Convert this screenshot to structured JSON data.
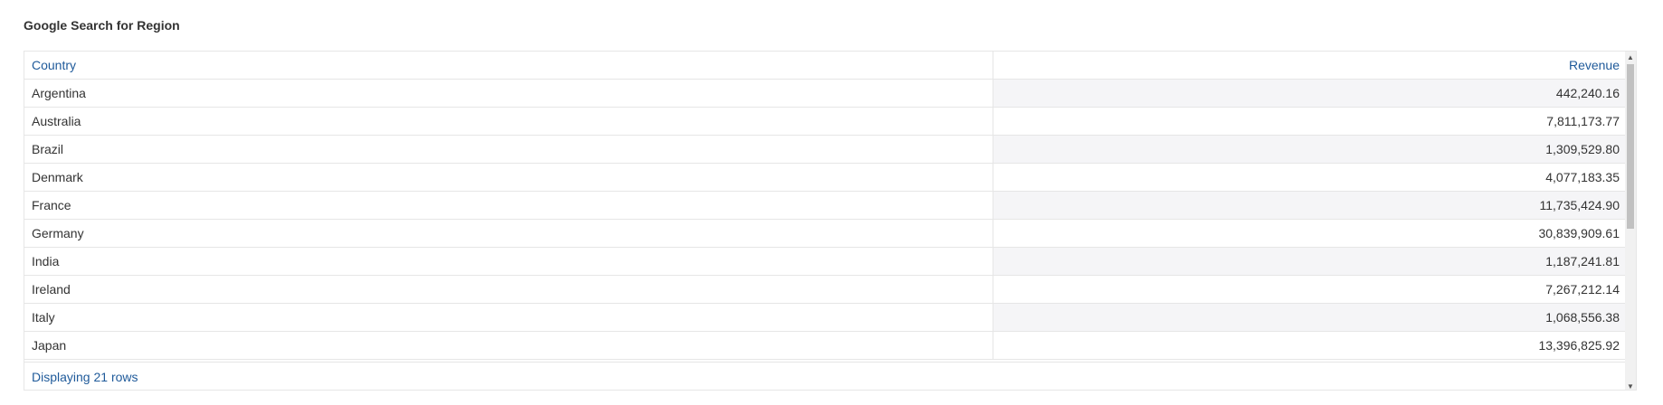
{
  "panel": {
    "title": "Google Search for Region"
  },
  "table": {
    "columns": [
      "Country",
      "Revenue"
    ],
    "rows": [
      {
        "country": "Argentina",
        "revenue": "442,240.16"
      },
      {
        "country": "Australia",
        "revenue": "7,811,173.77"
      },
      {
        "country": "Brazil",
        "revenue": "1,309,529.80"
      },
      {
        "country": "Denmark",
        "revenue": "4,077,183.35"
      },
      {
        "country": "France",
        "revenue": "11,735,424.90"
      },
      {
        "country": "Germany",
        "revenue": "30,839,909.61"
      },
      {
        "country": "India",
        "revenue": "1,187,241.81"
      },
      {
        "country": "Ireland",
        "revenue": "7,267,212.14"
      },
      {
        "country": "Italy",
        "revenue": "1,068,556.38"
      },
      {
        "country": "Japan",
        "revenue": "13,396,825.92"
      }
    ],
    "footer": "Displaying 21 rows"
  },
  "icons": {
    "scroll_up": "triangle-up-icon",
    "scroll_down": "triangle-down-icon"
  }
}
